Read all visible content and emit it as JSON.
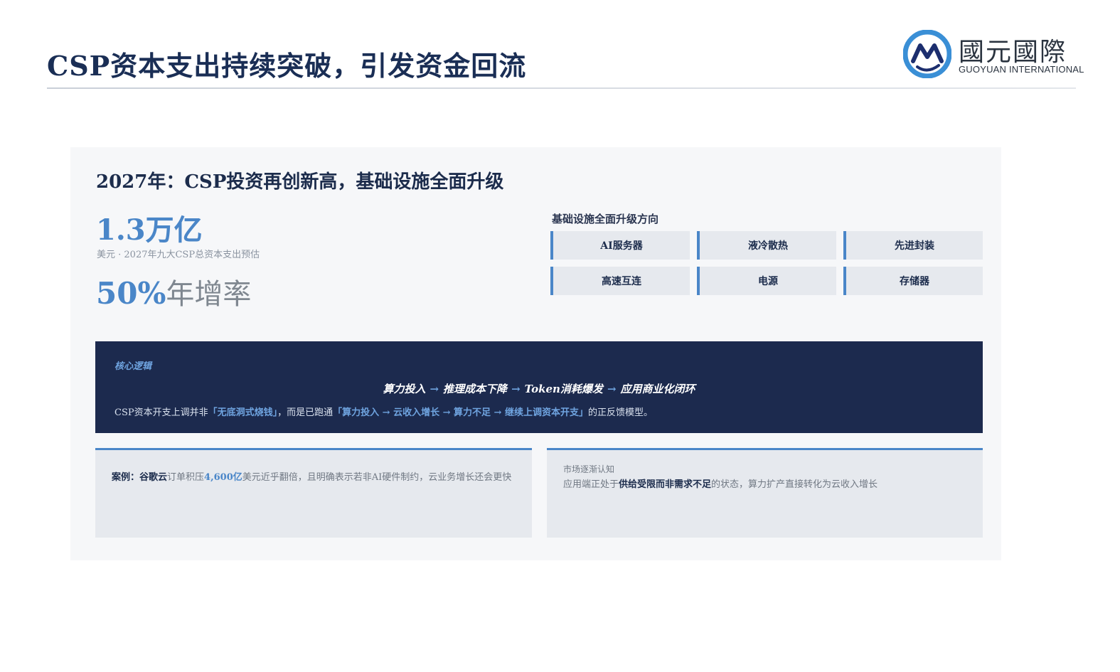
{
  "header": {
    "title": "CSP资本支出持续突破，引发资金回流",
    "logo_cn": "國元國際",
    "logo_en": "GUOYUAN INTERNATIONAL",
    "logo_icon": "guoyuan-logo-icon"
  },
  "card": {
    "title": "2027年：CSP投资再创新高，基础设施全面升级",
    "metric_value": "1.3万亿",
    "metric_caption": "美元 · 2027年九大CSP总资本支出预估",
    "growth_value": "50%",
    "growth_label": "年增率",
    "upgrade_title": "基础设施全面升级方向",
    "upgrade_items": [
      "AI服务器",
      "液冷散热",
      "先进封装",
      "高速互连",
      "电源",
      "存储器"
    ]
  },
  "logic": {
    "label": "核心逻辑",
    "chain": [
      "算力投入",
      "推理成本下降",
      "Token消耗爆发",
      "应用商业化闭环"
    ],
    "arrow": "→",
    "body_prefix": "CSP资本开支上调并非",
    "body_hl1": "「无底洞式烧钱」",
    "body_mid": "，而是已跑通",
    "body_hl2": "「算力投入 → 云收入增长 → 算力不足 → 继续上调资本开支」",
    "body_suffix": "的正反馈模型。"
  },
  "case": {
    "label": "案例：谷歌云",
    "text_a": "订单积压",
    "number": "4,600亿",
    "text_b": "美元近乎翻倍，且明确表示若非AI硬件制约，云业务增长还会更快"
  },
  "market": {
    "label": "市场逐渐认知",
    "text_a": "应用端正处于",
    "strong": "供给受限而非需求不足",
    "text_b": "的状态，算力扩产直接转化为云收入增长"
  },
  "colors": {
    "navy": "#1c2a4e",
    "accent_blue": "#4a86c8",
    "panel_gray": "#e6e9ee"
  }
}
